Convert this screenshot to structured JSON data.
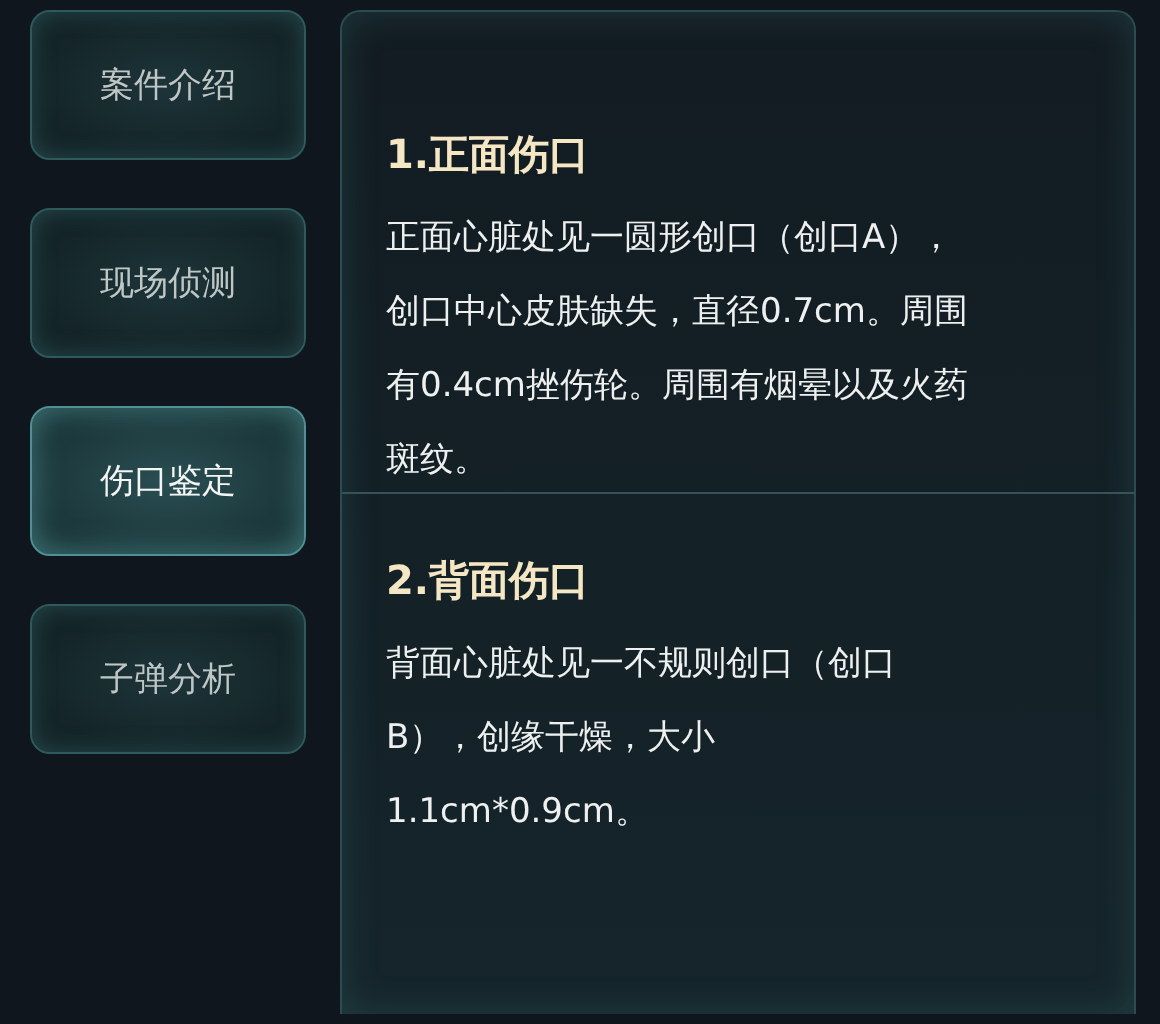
{
  "sidebar": {
    "items": [
      {
        "label": "案件介绍",
        "selected": false
      },
      {
        "label": "现场侦测",
        "selected": false
      },
      {
        "label": "伤口鉴定",
        "selected": true
      },
      {
        "label": "子弹分析",
        "selected": false
      }
    ]
  },
  "sections": [
    {
      "title": "1.正面伤口",
      "lines": [
        "正面心脏处见一圆形创口（创口A），",
        "创口中心皮肤缺失，直径0.7cm。周围",
        "有0.4cm挫伤轮。周围有烟晕以及火药",
        "斑纹。"
      ]
    },
    {
      "title": "2.背面伤口",
      "lines": [
        "背面心脏处见一不规则创口（创口",
        "B），创缘干燥，大小",
        "1.1cm*0.9cm。"
      ]
    }
  ]
}
